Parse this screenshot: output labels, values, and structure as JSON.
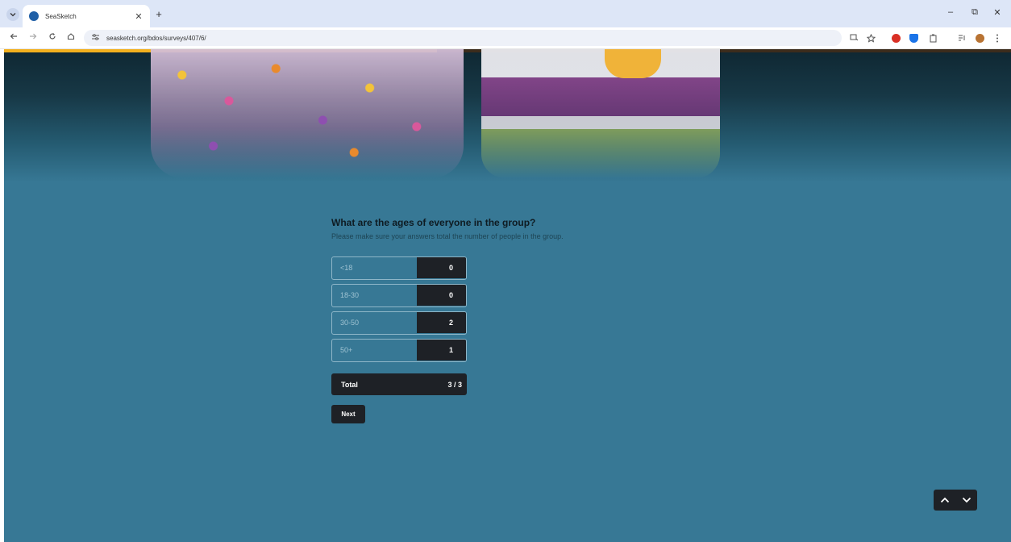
{
  "browser": {
    "tab_title": "SeaSketch",
    "url": "seasketch.org/bdos/surveys/407/6/",
    "new_tab_label": "+",
    "close_tab_label": "✕",
    "window_controls": {
      "minimize": "–",
      "restore": "⧉",
      "close": "✕"
    },
    "icons": [
      "chevron-down-icon",
      "back-icon",
      "forward-icon",
      "reload-icon",
      "home-icon",
      "site-info-icon",
      "install-icon",
      "star-icon",
      "extension-icons",
      "menu-icon"
    ],
    "colors": {
      "tab_strip": "#dde6f7",
      "favicon": "#1f5fa6"
    }
  },
  "survey": {
    "question": "What are the ages of everyone in the group?",
    "hint": "Please make sure your answers total the number of people in the group.",
    "rows": [
      {
        "label": "<18",
        "value": "0"
      },
      {
        "label": "18-30",
        "value": "0"
      },
      {
        "label": "30-50",
        "value": "2"
      },
      {
        "label": "50+",
        "value": "1"
      }
    ],
    "total_label": "Total",
    "total_value": "3 / 3",
    "next_label": "Next",
    "colors": {
      "background": "#377895",
      "dark": "#1e2126",
      "row_border": "#8eb6c8"
    }
  },
  "pager": {
    "up_icon": "chevron-up-icon",
    "down_icon": "chevron-down-icon"
  }
}
